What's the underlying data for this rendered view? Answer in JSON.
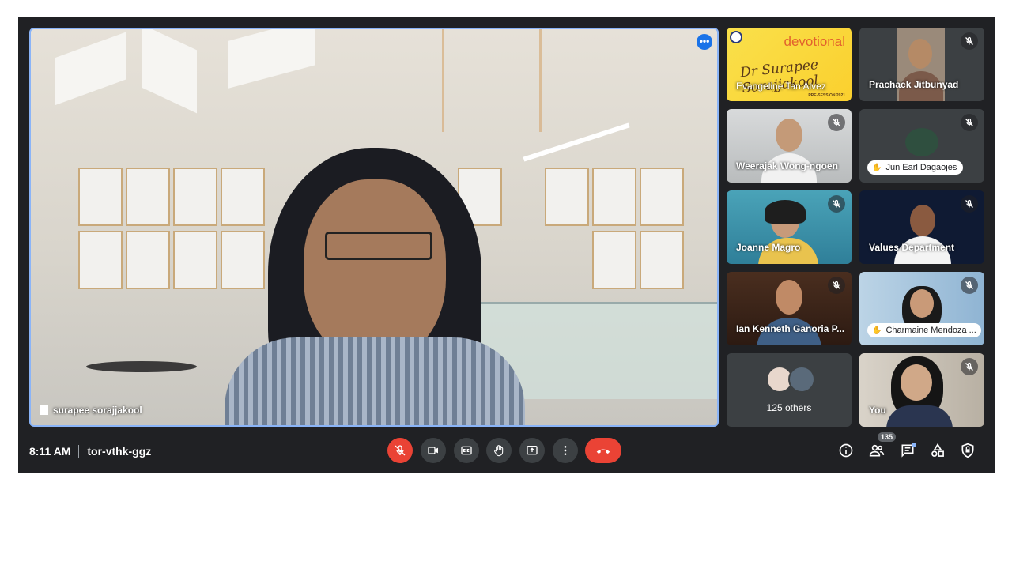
{
  "meeting": {
    "time": "8:11 AM",
    "code": "tor-vthk-ggz",
    "participant_count": "135"
  },
  "speaker": {
    "name": "surapee sorajjakool"
  },
  "tiles": [
    {
      "name": "Evangeline Tan Alvez",
      "banner_title": "devotional",
      "banner_name": "Dr Surapee Sorajjakool",
      "banner_small": "PRE-SESSION 2021"
    },
    {
      "name": "Prachack Jitbunyad"
    },
    {
      "name": "Weerajak Wong-ngoen"
    },
    {
      "name": "Jun Earl Dagaojes"
    },
    {
      "name": "Joanne Magro"
    },
    {
      "name": "Values Department"
    },
    {
      "name": "Ian Kenneth Ganoria P..."
    },
    {
      "name": "Charmaine Mendoza ..."
    },
    {
      "others_label": "125 others"
    },
    {
      "name": "You"
    }
  ],
  "colors": {
    "background": "#202124",
    "tile": "#3c4043",
    "accent": "#8ab4f8",
    "danger": "#ea4335"
  },
  "icons": {
    "controls": [
      "mic-off-icon",
      "camera-icon",
      "captions-icon",
      "raise-hand-icon",
      "present-icon",
      "more-vert-icon",
      "end-call-icon"
    ],
    "right": [
      "info-icon",
      "people-icon",
      "chat-icon",
      "activities-icon",
      "host-controls-icon"
    ]
  }
}
